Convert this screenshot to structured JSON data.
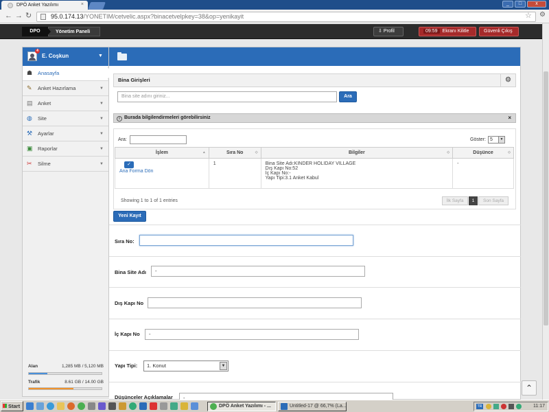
{
  "browser": {
    "tab_title": "DPÖ Anket Yazılımı",
    "tab_close": "×",
    "url_host": "95.0.174.13",
    "url_path": "/YONETIM/cetvelic.aspx?binacetvelpkey=38&op=yenikayit",
    "win_min": "_",
    "win_max": "□",
    "win_close": "x"
  },
  "topbar": {
    "crumb_home": "DPO",
    "crumb_panel": "Yönetim Paneli",
    "profile_label": "Profil",
    "session_time": "09:59",
    "lock_label": "Ekranı Kilitle",
    "logout_label": "Güvenli Çıkış"
  },
  "sidebar": {
    "user_name": "E. Coşkun",
    "notification_count": "4",
    "items": [
      {
        "label": "Anasayfa",
        "icon": "home-icon"
      },
      {
        "label": "Anket Hazırlama",
        "icon": "edit-icon"
      },
      {
        "label": "Anket",
        "icon": "list-icon"
      },
      {
        "label": "Site",
        "icon": "globe-icon"
      },
      {
        "label": "Ayarlar",
        "icon": "settings-icon"
      },
      {
        "label": "Raporlar",
        "icon": "report-icon"
      },
      {
        "label": "Silme",
        "icon": "delete-icon"
      }
    ],
    "quota": {
      "storage_label": "Alan",
      "storage_value": "1,285 MB / 5,120 MB",
      "storage_fraction": 0.25,
      "storage_color": "#4a90d9",
      "traffic_label": "Trafik",
      "traffic_value": "8.61 GB / 14.00 GB",
      "traffic_fraction": 0.615,
      "traffic_color": "#f0922b"
    }
  },
  "content": {
    "section_title": "Bina Girişleri",
    "search_placeholder": "Bina site adını giriniz...",
    "search_button": "Ara",
    "info_text": "Burada bilgilendirmeleri görebilirsiniz",
    "info_close": "×",
    "table": {
      "filter_label": "Ara:",
      "show_label": "Göster:",
      "page_size": "5",
      "columns": [
        "İşlem",
        "Sıra No",
        "Bilgiler",
        "Düşünce"
      ],
      "row": {
        "action_label": "Ana Forma Dön",
        "sira_no": "1",
        "info_lines": [
          "Bina Site Adı:KINDER HOLIDAY VILLAGE",
          "Dış Kapı No:52",
          "İç Kapı No:-",
          "Yapı Tipi:3.1 Anket Kabul"
        ],
        "dusunce": "-"
      },
      "footer_text": "Showing 1 to 1 of 1 entries",
      "first_page": "İlk Sayfa",
      "current_page": "1",
      "last_page": "Son Sayfa"
    },
    "new_record_button": "Yeni Kayıt",
    "form": {
      "sira_no_label": "Sıra No:",
      "sira_no_value": "",
      "bina_site_label": "Bina Site Adı",
      "bina_site_value": "-",
      "dis_kapi_label": "Dış Kapı No",
      "dis_kapi_value": "",
      "ic_kapi_label": "İç Kapı No",
      "ic_kapi_value": "-",
      "yapi_tipi_label": "Yapı Tipi:",
      "yapi_tipi_value": "1. Konut",
      "dusunceler_label": "Düşünceler Açıklamalar",
      "dusunceler_value": "-"
    }
  },
  "taskbar": {
    "start_label": "Start",
    "tasks": [
      {
        "label": "DPÖ Anket Yazılımı - ...",
        "active": true
      },
      {
        "label": "Untitled-17 @ 66,7% (La...",
        "active": false
      }
    ],
    "tray_lang": "TR",
    "clock": "11:17"
  }
}
